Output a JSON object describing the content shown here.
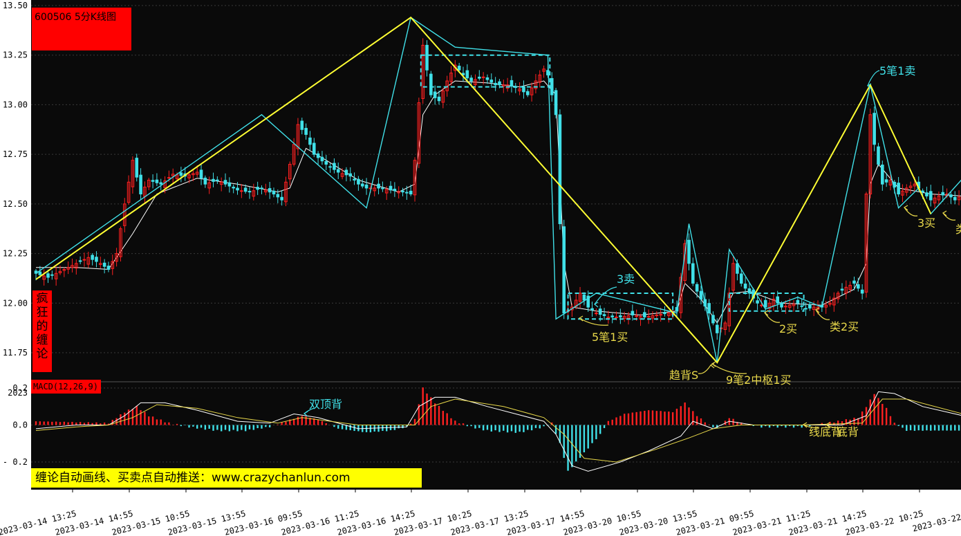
{
  "colors": {
    "background": "#0a0a0a",
    "axis_panel": "#ffffff",
    "up_candle": "#ff2020",
    "down_candle": "#40e0e8",
    "ma_line": "#ffffff",
    "stroke_line": "#40e0e8",
    "segment_line": "#ffff33",
    "annotation_yellow": "#e8d84a",
    "annotation_cyan": "#40e0e8",
    "label_box": "#ff0000",
    "promo_box": "#ffff00"
  },
  "header": {
    "title": "600506 5分K线图",
    "side_label": [
      "疯",
      "狂",
      "的",
      "缠",
      "论"
    ],
    "macd_label": "MACD(12,26,9)",
    "promo": "缠论自动画线、买卖点自动推送：www.crazychanlun.com",
    "stray_axis_text": "2023"
  },
  "chart_data": [
    {
      "type": "candlestick",
      "title": "600506 5分K线图",
      "ylim": [
        11.66,
        13.5
      ],
      "y_ticks": [
        "13.50",
        "13.25",
        "13.00",
        "12.75",
        "12.50",
        "12.25",
        "12.00",
        "11.75"
      ],
      "x_ticks": [
        "2023-03-14 13:25",
        "2023-03-14 14:55",
        "2023-03-15 10:55",
        "2023-03-15 13:55",
        "2023-03-16 09:55",
        "2023-03-16 11:25",
        "2023-03-16 14:25",
        "2023-03-17 10:25",
        "2023-03-17 13:25",
        "2023-03-17 14:55",
        "2023-03-20 10:55",
        "2023-03-20 13:55",
        "2023-03-21 09:55",
        "2023-03-21 11:25",
        "2023-03-21 14:25",
        "2023-03-22 10:25",
        "2023-03-22"
      ],
      "price_path": [
        [
          0,
          12.15
        ],
        [
          3,
          12.13
        ],
        [
          7,
          12.17
        ],
        [
          10,
          12.2
        ],
        [
          13,
          12.23
        ],
        [
          16,
          12.2
        ],
        [
          18,
          12.17
        ],
        [
          20,
          12.25
        ],
        [
          22,
          12.5
        ],
        [
          24,
          12.72
        ],
        [
          26,
          12.55
        ],
        [
          28,
          12.62
        ],
        [
          31,
          12.6
        ],
        [
          34,
          12.65
        ],
        [
          37,
          12.64
        ],
        [
          40,
          12.66
        ],
        [
          42,
          12.6
        ],
        [
          45,
          12.62
        ],
        [
          47,
          12.6
        ],
        [
          50,
          12.57
        ],
        [
          53,
          12.56
        ],
        [
          56,
          12.58
        ],
        [
          59,
          12.55
        ],
        [
          61,
          12.52
        ],
        [
          63,
          12.7
        ],
        [
          65,
          12.9
        ],
        [
          67,
          12.85
        ],
        [
          69,
          12.75
        ],
        [
          72,
          12.7
        ],
        [
          75,
          12.66
        ],
        [
          78,
          12.64
        ],
        [
          80,
          12.6
        ],
        [
          82,
          12.58
        ],
        [
          85,
          12.58
        ],
        [
          88,
          12.57
        ],
        [
          91,
          12.56
        ],
        [
          93,
          12.55
        ],
        [
          94,
          12.72
        ],
        [
          96,
          13.3
        ],
        [
          98,
          13.05
        ],
        [
          100,
          13.02
        ],
        [
          102,
          13.12
        ],
        [
          104,
          13.2
        ],
        [
          106,
          13.15
        ],
        [
          108,
          13.12
        ],
        [
          111,
          13.14
        ],
        [
          114,
          13.1
        ],
        [
          117,
          13.1
        ],
        [
          120,
          13.08
        ],
        [
          122,
          13.05
        ],
        [
          124,
          13.12
        ],
        [
          126,
          13.18
        ],
        [
          127,
          13.15
        ],
        [
          129,
          12.95
        ],
        [
          130,
          12.4
        ],
        [
          131,
          11.95
        ],
        [
          133,
          11.98
        ],
        [
          135,
          12.05
        ],
        [
          137,
          11.98
        ],
        [
          139,
          11.95
        ],
        [
          142,
          11.93
        ],
        [
          145,
          11.93
        ],
        [
          148,
          11.94
        ],
        [
          151,
          11.93
        ],
        [
          154,
          11.94
        ],
        [
          157,
          11.95
        ],
        [
          159,
          11.96
        ],
        [
          161,
          12.3
        ],
        [
          163,
          12.1
        ],
        [
          165,
          12.02
        ],
        [
          167,
          11.95
        ],
        [
          169,
          11.85
        ],
        [
          171,
          11.9
        ],
        [
          173,
          12.2
        ],
        [
          175,
          12.1
        ],
        [
          177,
          12.05
        ],
        [
          179,
          12.0
        ],
        [
          181,
          11.98
        ],
        [
          183,
          12.02
        ],
        [
          185,
          11.98
        ],
        [
          187,
          11.99
        ],
        [
          189,
          12.0
        ],
        [
          191,
          11.97
        ],
        [
          193,
          11.98
        ],
        [
          195,
          11.98
        ],
        [
          197,
          12.0
        ],
        [
          199,
          12.05
        ],
        [
          201,
          12.08
        ],
        [
          203,
          12.1
        ],
        [
          205,
          12.05
        ],
        [
          206,
          12.55
        ],
        [
          207,
          12.95
        ],
        [
          208,
          12.8
        ],
        [
          210,
          12.6
        ],
        [
          212,
          12.62
        ],
        [
          214,
          12.55
        ],
        [
          216,
          12.58
        ],
        [
          218,
          12.6
        ],
        [
          220,
          12.56
        ],
        [
          222,
          12.52
        ],
        [
          224,
          12.54
        ],
        [
          226,
          12.55
        ],
        [
          228,
          12.52
        ],
        [
          230,
          12.55
        ]
      ],
      "ma_path": [
        [
          0,
          12.18
        ],
        [
          10,
          12.18
        ],
        [
          18,
          12.17
        ],
        [
          24,
          12.35
        ],
        [
          30,
          12.55
        ],
        [
          40,
          12.63
        ],
        [
          50,
          12.6
        ],
        [
          60,
          12.56
        ],
        [
          63,
          12.58
        ],
        [
          67,
          12.78
        ],
        [
          72,
          12.72
        ],
        [
          80,
          12.62
        ],
        [
          90,
          12.56
        ],
        [
          94,
          12.6
        ],
        [
          96,
          12.95
        ],
        [
          99,
          13.05
        ],
        [
          104,
          13.12
        ],
        [
          112,
          13.11
        ],
        [
          120,
          13.09
        ],
        [
          126,
          13.12
        ],
        [
          129,
          13.05
        ],
        [
          131,
          12.2
        ],
        [
          133,
          11.98
        ],
        [
          139,
          11.96
        ],
        [
          150,
          11.94
        ],
        [
          159,
          11.96
        ],
        [
          161,
          12.1
        ],
        [
          165,
          12.02
        ],
        [
          169,
          11.9
        ],
        [
          173,
          12.05
        ],
        [
          177,
          12.06
        ],
        [
          185,
          12.0
        ],
        [
          195,
          11.99
        ],
        [
          203,
          12.07
        ],
        [
          206,
          12.2
        ],
        [
          207,
          12.6
        ],
        [
          209,
          12.7
        ],
        [
          214,
          12.58
        ],
        [
          222,
          12.55
        ],
        [
          230,
          12.54
        ]
      ],
      "bi_strokes": [
        [
          0,
          12.15
        ],
        [
          56,
          12.95
        ],
        [
          82,
          12.48
        ],
        [
          93,
          13.44
        ],
        [
          104,
          13.29
        ],
        [
          127,
          13.25
        ],
        [
          129,
          11.92
        ],
        [
          139,
          12.05
        ],
        [
          159,
          11.95
        ],
        [
          162,
          12.4
        ],
        [
          169,
          11.7
        ],
        [
          172,
          12.27
        ],
        [
          181,
          11.97
        ],
        [
          189,
          12.03
        ],
        [
          195,
          11.98
        ],
        [
          207,
          13.1
        ],
        [
          214,
          12.48
        ],
        [
          219,
          12.58
        ],
        [
          222,
          12.45
        ],
        [
          230,
          12.63
        ]
      ],
      "segments": [
        [
          0,
          12.12
        ],
        [
          93,
          13.44
        ],
        [
          169,
          11.7
        ],
        [
          207,
          13.1
        ],
        [
          222,
          12.45
        ]
      ],
      "zhongshu_boxes": [
        [
          95.5,
          127.5,
          13.09,
          13.25
        ],
        [
          132,
          158,
          11.92,
          12.05
        ],
        [
          172,
          190.5,
          11.96,
          12.05
        ]
      ],
      "annotations": [
        {
          "text": "3卖",
          "color": "cyan"
        },
        {
          "text": "5笔1卖",
          "color": "cyan"
        },
        {
          "text": "5笔1买",
          "color": "yellow"
        },
        {
          "text": "趋背S",
          "color": "yellow"
        },
        {
          "text": "9笔2中枢1买",
          "color": "yellow"
        },
        {
          "text": "2买",
          "color": "yellow"
        },
        {
          "text": "类2买",
          "color": "yellow"
        },
        {
          "text": "3买",
          "color": "yellow"
        },
        {
          "text": "类",
          "color": "yellow"
        }
      ]
    },
    {
      "type": "bar",
      "title": "MACD(12,26,9)",
      "ylim": [
        -0.26,
        0.2
      ],
      "y_ticks": [
        "0.2",
        "0.0",
        "- 0.2"
      ],
      "hist_path": [
        [
          0,
          0.02
        ],
        [
          10,
          0.015
        ],
        [
          18,
          0.01
        ],
        [
          22,
          0.07
        ],
        [
          25,
          0.1
        ],
        [
          28,
          0.05
        ],
        [
          33,
          0.01
        ],
        [
          38,
          -0.01
        ],
        [
          45,
          -0.03
        ],
        [
          52,
          -0.03
        ],
        [
          58,
          -0.01
        ],
        [
          62,
          0.02
        ],
        [
          66,
          0.05
        ],
        [
          70,
          0.03
        ],
        [
          75,
          -0.02
        ],
        [
          82,
          -0.04
        ],
        [
          88,
          -0.03
        ],
        [
          92,
          -0.01
        ],
        [
          94,
          0.03
        ],
        [
          96,
          0.2
        ],
        [
          99,
          0.12
        ],
        [
          104,
          0.02
        ],
        [
          108,
          -0.01
        ],
        [
          112,
          -0.03
        ],
        [
          120,
          -0.04
        ],
        [
          126,
          -0.01
        ],
        [
          128,
          0.01
        ],
        [
          130,
          -0.1
        ],
        [
          132,
          -0.25
        ],
        [
          136,
          -0.15
        ],
        [
          140,
          -0.05
        ],
        [
          142,
          0.02
        ],
        [
          146,
          0.06
        ],
        [
          152,
          0.08
        ],
        [
          158,
          0.07
        ],
        [
          161,
          0.12
        ],
        [
          164,
          0.05
        ],
        [
          167,
          0.0
        ],
        [
          169,
          -0.02
        ],
        [
          172,
          0.04
        ],
        [
          175,
          0.01
        ],
        [
          180,
          -0.01
        ],
        [
          190,
          -0.01
        ],
        [
          199,
          0.02
        ],
        [
          204,
          0.04
        ],
        [
          206,
          0.1
        ],
        [
          208,
          0.17
        ],
        [
          211,
          0.09
        ],
        [
          213,
          0.01
        ],
        [
          216,
          -0.03
        ],
        [
          230,
          -0.03
        ]
      ],
      "dif_path": [
        [
          0,
          -0.02
        ],
        [
          10,
          0.0
        ],
        [
          18,
          0.0
        ],
        [
          22,
          0.05
        ],
        [
          26,
          0.12
        ],
        [
          32,
          0.12
        ],
        [
          40,
          0.08
        ],
        [
          50,
          0.02
        ],
        [
          58,
          0.01
        ],
        [
          64,
          0.06
        ],
        [
          70,
          0.04
        ],
        [
          80,
          -0.02
        ],
        [
          92,
          -0.01
        ],
        [
          95,
          0.1
        ],
        [
          99,
          0.15
        ],
        [
          104,
          0.15
        ],
        [
          112,
          0.1
        ],
        [
          126,
          0.02
        ],
        [
          129,
          -0.05
        ],
        [
          133,
          -0.22
        ],
        [
          137,
          -0.25
        ],
        [
          145,
          -0.2
        ],
        [
          152,
          -0.14
        ],
        [
          160,
          -0.06
        ],
        [
          163,
          0.02
        ],
        [
          168,
          -0.02
        ],
        [
          172,
          0.02
        ],
        [
          178,
          0.0
        ],
        [
          190,
          0.0
        ],
        [
          200,
          0.0
        ],
        [
          206,
          0.05
        ],
        [
          209,
          0.18
        ],
        [
          213,
          0.17
        ],
        [
          220,
          0.1
        ],
        [
          230,
          0.05
        ]
      ],
      "dea_path": [
        [
          0,
          -0.03
        ],
        [
          10,
          -0.01
        ],
        [
          18,
          0.0
        ],
        [
          24,
          0.04
        ],
        [
          30,
          0.11
        ],
        [
          40,
          0.09
        ],
        [
          50,
          0.04
        ],
        [
          60,
          0.01
        ],
        [
          66,
          0.04
        ],
        [
          80,
          0.0
        ],
        [
          94,
          0.0
        ],
        [
          98,
          0.1
        ],
        [
          104,
          0.14
        ],
        [
          116,
          0.1
        ],
        [
          126,
          0.04
        ],
        [
          131,
          -0.05
        ],
        [
          136,
          -0.18
        ],
        [
          144,
          -0.2
        ],
        [
          154,
          -0.13
        ],
        [
          162,
          -0.07
        ],
        [
          168,
          -0.02
        ],
        [
          175,
          0.0
        ],
        [
          190,
          0.0
        ],
        [
          205,
          0.01
        ],
        [
          210,
          0.14
        ],
        [
          216,
          0.14
        ],
        [
          230,
          0.06
        ]
      ],
      "annotations": [
        {
          "text": "双顶背",
          "color": "cyan"
        },
        {
          "text": "线底背",
          "color": "yellow"
        },
        {
          "text": "底背",
          "color": "yellow"
        }
      ]
    }
  ]
}
